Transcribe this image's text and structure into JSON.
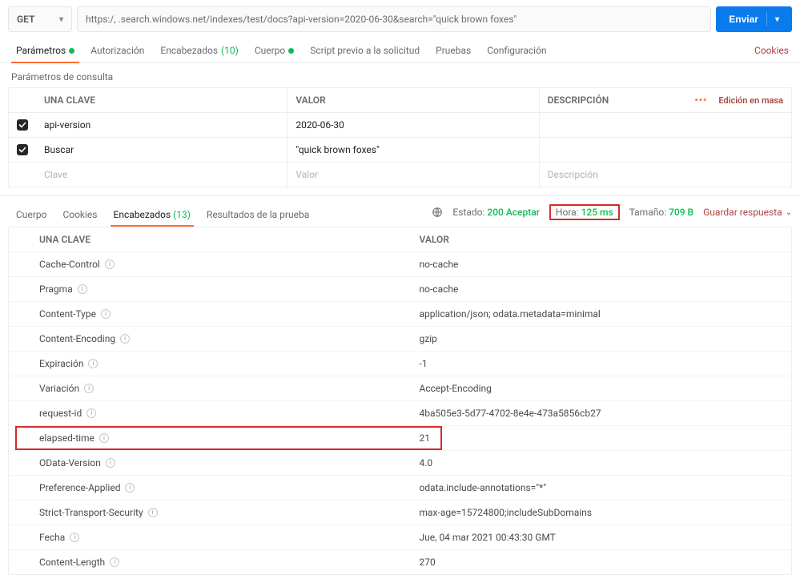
{
  "request": {
    "method": "GET",
    "url": "https:/,            .search.windows.net/indexes/test/docs?api-version=2020-06-30&search=\"quick brown foxes\"",
    "send_label": "Enviar"
  },
  "req_tabs": {
    "params": "Parámetros",
    "auth": "Autorización",
    "headers": "Encabezados",
    "headers_count": "(10)",
    "body": "Cuerpo",
    "prereq": "Script previo a la solicitud",
    "tests": "Pruebas",
    "settings": "Configuración",
    "cookies": "Cookies"
  },
  "params": {
    "title": "Parámetros de consulta",
    "col_key": "UNA CLAVE",
    "col_value": "VALOR",
    "col_desc": "DESCRIPCIÓN",
    "bulk_edit": "Edición en masa",
    "rows": [
      {
        "key": "api-version",
        "value": "2020-06-30"
      },
      {
        "key": "Buscar",
        "value": "\"quick brown foxes\""
      }
    ],
    "ph_key": "Clave",
    "ph_value": "Valor",
    "ph_desc": "Descripción"
  },
  "resp_tabs": {
    "body": "Cuerpo",
    "cookies": "Cookies",
    "headers": "Encabezados",
    "headers_count": "(13)",
    "test_results": "Resultados de la prueba"
  },
  "resp_stats": {
    "status_label": "Estado:",
    "status_value": "200 Aceptar",
    "time_label": "Hora:",
    "time_value": "125 ms",
    "size_label": "Tamaño:",
    "size_value": "709 B",
    "save": "Guardar respuesta"
  },
  "headers": {
    "col_key": "UNA CLAVE",
    "col_value": "VALOR",
    "rows": [
      {
        "key": "Cache-Control",
        "value": "no-cache"
      },
      {
        "key": "Pragma",
        "value": "no-cache"
      },
      {
        "key": "Content-Type",
        "value": "application/json; odata.metadata=minimal"
      },
      {
        "key": "Content-Encoding",
        "value": "gzip"
      },
      {
        "key": "Expiración",
        "value": "-1"
      },
      {
        "key": "Variación",
        "value": "Accept-Encoding"
      },
      {
        "key": "request-id",
        "value": "4ba505e3-5d77-4702-8e4e-473a5856cb27"
      },
      {
        "key": "elapsed-time",
        "value": "21",
        "highlight": true
      },
      {
        "key": "OData-Version",
        "value": "4.0"
      },
      {
        "key": "Preference-Applied",
        "value": "odata.include-annotations=\"*\""
      },
      {
        "key": "Strict-Transport-Security",
        "value": "max-age=15724800;includeSubDomains"
      },
      {
        "key": "Fecha",
        "value": "Jue, 04 mar 2021 00:43:30 GMT"
      },
      {
        "key": "Content-Length",
        "value": "270"
      }
    ]
  }
}
